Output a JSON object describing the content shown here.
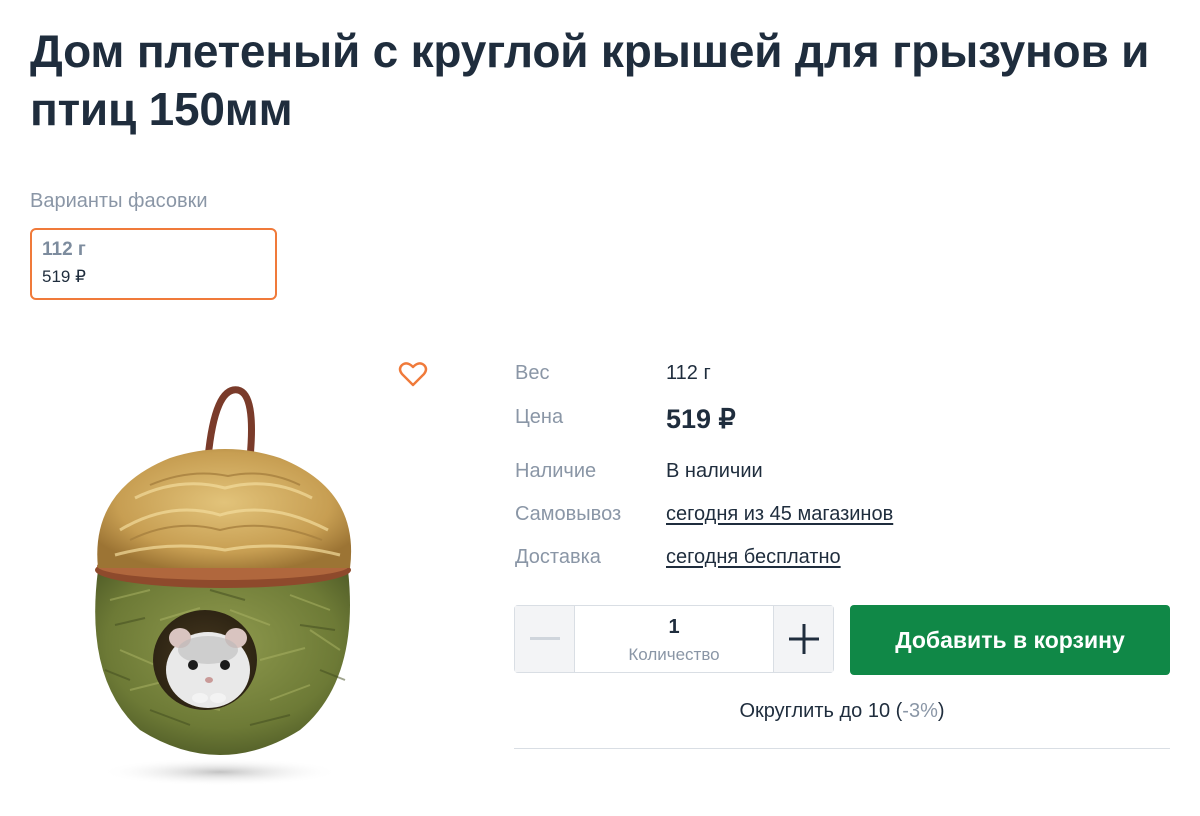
{
  "product": {
    "title": "Дом плетеный с круглой крышей для грызунов и птиц 150мм"
  },
  "variants": {
    "label": "Варианты фасовки",
    "items": [
      {
        "weight": "112 г",
        "price": "519 ₽"
      }
    ]
  },
  "specs": {
    "weight_label": "Вес",
    "weight_value": "112 г",
    "price_label": "Цена",
    "price_value": "519 ₽",
    "availability_label": "Наличие",
    "availability_value": "В наличии",
    "pickup_label": "Самовывоз",
    "pickup_value": "сегодня из 45 магазинов",
    "delivery_label": "Доставка",
    "delivery_value": "сегодня бесплатно"
  },
  "quantity": {
    "value": "1",
    "label": "Количество"
  },
  "cart": {
    "add_label": "Добавить в корзину"
  },
  "round": {
    "text": "Округлить до 10 (",
    "discount": "-3%",
    "close": ")"
  },
  "colors": {
    "accent_orange": "#f07a3a",
    "primary_green": "#108847",
    "text_dark": "#1f2d3d",
    "text_muted": "#8a96a6"
  },
  "icons": {
    "favorite": "heart-icon",
    "minus": "minus-icon",
    "plus": "plus-icon"
  }
}
